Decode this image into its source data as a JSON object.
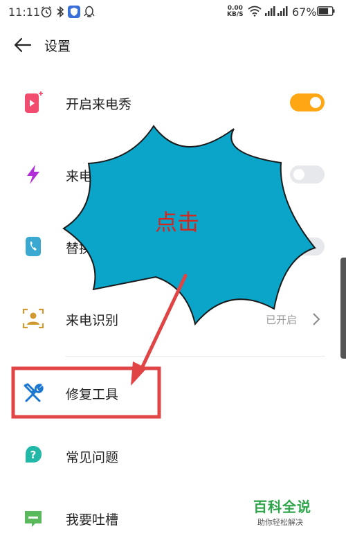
{
  "status_bar": {
    "time": "11:11",
    "net_speed_value": "0.00",
    "net_speed_unit": "KB/S",
    "battery": "67%"
  },
  "header": {
    "title": "设置"
  },
  "settings": {
    "show_call": {
      "label": "开启来电秀",
      "enabled": true
    },
    "flash": {
      "label": "来电闪光",
      "enabled": false
    },
    "replace": {
      "label": "替换铃声",
      "enabled": false
    },
    "caller_id": {
      "label": "来电识别",
      "value": "已开启"
    },
    "repair": {
      "label": "修复工具"
    },
    "faq": {
      "label": "常见问题"
    },
    "feedback": {
      "label": "我要吐槽"
    }
  },
  "visible_labels": {
    "flash": "来电",
    "replace": "替换"
  },
  "annotation": {
    "burst_text": "点击",
    "burst_color": "#0aa5c8",
    "arrow_color": "#e04444",
    "highlight_color": "#e04444"
  },
  "watermark": {
    "title": "百科全说",
    "subtitle": "助你轻松解决"
  }
}
